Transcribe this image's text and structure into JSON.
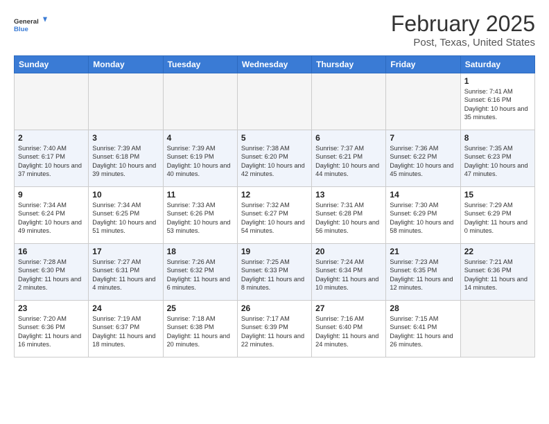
{
  "header": {
    "logo_general": "General",
    "logo_blue": "Blue",
    "month_title": "February 2025",
    "location": "Post, Texas, United States"
  },
  "days_of_week": [
    "Sunday",
    "Monday",
    "Tuesday",
    "Wednesday",
    "Thursday",
    "Friday",
    "Saturday"
  ],
  "weeks": [
    [
      {
        "day": "",
        "info": ""
      },
      {
        "day": "",
        "info": ""
      },
      {
        "day": "",
        "info": ""
      },
      {
        "day": "",
        "info": ""
      },
      {
        "day": "",
        "info": ""
      },
      {
        "day": "",
        "info": ""
      },
      {
        "day": "1",
        "info": "Sunrise: 7:41 AM\nSunset: 6:16 PM\nDaylight: 10 hours\nand 35 minutes."
      }
    ],
    [
      {
        "day": "2",
        "info": "Sunrise: 7:40 AM\nSunset: 6:17 PM\nDaylight: 10 hours\nand 37 minutes."
      },
      {
        "day": "3",
        "info": "Sunrise: 7:39 AM\nSunset: 6:18 PM\nDaylight: 10 hours\nand 39 minutes."
      },
      {
        "day": "4",
        "info": "Sunrise: 7:39 AM\nSunset: 6:19 PM\nDaylight: 10 hours\nand 40 minutes."
      },
      {
        "day": "5",
        "info": "Sunrise: 7:38 AM\nSunset: 6:20 PM\nDaylight: 10 hours\nand 42 minutes."
      },
      {
        "day": "6",
        "info": "Sunrise: 7:37 AM\nSunset: 6:21 PM\nDaylight: 10 hours\nand 44 minutes."
      },
      {
        "day": "7",
        "info": "Sunrise: 7:36 AM\nSunset: 6:22 PM\nDaylight: 10 hours\nand 45 minutes."
      },
      {
        "day": "8",
        "info": "Sunrise: 7:35 AM\nSunset: 6:23 PM\nDaylight: 10 hours\nand 47 minutes."
      }
    ],
    [
      {
        "day": "9",
        "info": "Sunrise: 7:34 AM\nSunset: 6:24 PM\nDaylight: 10 hours\nand 49 minutes."
      },
      {
        "day": "10",
        "info": "Sunrise: 7:34 AM\nSunset: 6:25 PM\nDaylight: 10 hours\nand 51 minutes."
      },
      {
        "day": "11",
        "info": "Sunrise: 7:33 AM\nSunset: 6:26 PM\nDaylight: 10 hours\nand 53 minutes."
      },
      {
        "day": "12",
        "info": "Sunrise: 7:32 AM\nSunset: 6:27 PM\nDaylight: 10 hours\nand 54 minutes."
      },
      {
        "day": "13",
        "info": "Sunrise: 7:31 AM\nSunset: 6:28 PM\nDaylight: 10 hours\nand 56 minutes."
      },
      {
        "day": "14",
        "info": "Sunrise: 7:30 AM\nSunset: 6:29 PM\nDaylight: 10 hours\nand 58 minutes."
      },
      {
        "day": "15",
        "info": "Sunrise: 7:29 AM\nSunset: 6:29 PM\nDaylight: 11 hours\nand 0 minutes."
      }
    ],
    [
      {
        "day": "16",
        "info": "Sunrise: 7:28 AM\nSunset: 6:30 PM\nDaylight: 11 hours\nand 2 minutes."
      },
      {
        "day": "17",
        "info": "Sunrise: 7:27 AM\nSunset: 6:31 PM\nDaylight: 11 hours\nand 4 minutes."
      },
      {
        "day": "18",
        "info": "Sunrise: 7:26 AM\nSunset: 6:32 PM\nDaylight: 11 hours\nand 6 minutes."
      },
      {
        "day": "19",
        "info": "Sunrise: 7:25 AM\nSunset: 6:33 PM\nDaylight: 11 hours\nand 8 minutes."
      },
      {
        "day": "20",
        "info": "Sunrise: 7:24 AM\nSunset: 6:34 PM\nDaylight: 11 hours\nand 10 minutes."
      },
      {
        "day": "21",
        "info": "Sunrise: 7:23 AM\nSunset: 6:35 PM\nDaylight: 11 hours\nand 12 minutes."
      },
      {
        "day": "22",
        "info": "Sunrise: 7:21 AM\nSunset: 6:36 PM\nDaylight: 11 hours\nand 14 minutes."
      }
    ],
    [
      {
        "day": "23",
        "info": "Sunrise: 7:20 AM\nSunset: 6:36 PM\nDaylight: 11 hours\nand 16 minutes."
      },
      {
        "day": "24",
        "info": "Sunrise: 7:19 AM\nSunset: 6:37 PM\nDaylight: 11 hours\nand 18 minutes."
      },
      {
        "day": "25",
        "info": "Sunrise: 7:18 AM\nSunset: 6:38 PM\nDaylight: 11 hours\nand 20 minutes."
      },
      {
        "day": "26",
        "info": "Sunrise: 7:17 AM\nSunset: 6:39 PM\nDaylight: 11 hours\nand 22 minutes."
      },
      {
        "day": "27",
        "info": "Sunrise: 7:16 AM\nSunset: 6:40 PM\nDaylight: 11 hours\nand 24 minutes."
      },
      {
        "day": "28",
        "info": "Sunrise: 7:15 AM\nSunset: 6:41 PM\nDaylight: 11 hours\nand 26 minutes."
      },
      {
        "day": "",
        "info": ""
      }
    ]
  ]
}
